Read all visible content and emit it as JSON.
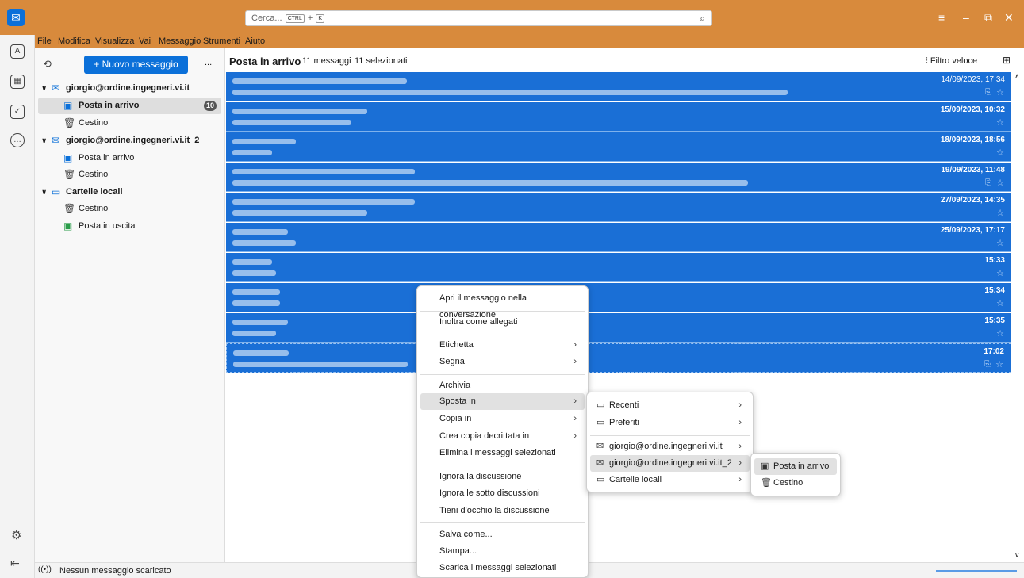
{
  "search": {
    "placeholder": "Cerca...",
    "kbd1": "CTRL",
    "plus": "+",
    "kbd2": "K"
  },
  "menubar": [
    "File",
    "Modifica",
    "Visualizza",
    "Vai",
    "Messaggio",
    "Strumenti",
    "Aiuto"
  ],
  "folders": {
    "new_message": "+ Nuovo messaggio",
    "more": "...",
    "items": [
      {
        "label": "giorgio@ordine.ingegneri.vi.it",
        "type": "account"
      },
      {
        "label": "Posta in arrivo",
        "type": "inbox",
        "unread": "10"
      },
      {
        "label": "Cestino",
        "type": "trash"
      },
      {
        "label": "giorgio@ordine.ingegneri.vi.it_2",
        "type": "account"
      },
      {
        "label": "Posta in arrivo",
        "type": "inbox"
      },
      {
        "label": "Cestino",
        "type": "trash"
      },
      {
        "label": "Cartelle locali",
        "type": "local"
      },
      {
        "label": "Cestino",
        "type": "trash"
      },
      {
        "label": "Posta in uscita",
        "type": "outbox"
      }
    ]
  },
  "list": {
    "title": "Posta in arrivo",
    "count": "11 messaggi",
    "selected": "11 selezionati",
    "quick_filter": "Filtro veloce",
    "messages": [
      {
        "date": "14/09/2023, 17:34",
        "attachment": true
      },
      {
        "date": "15/09/2023, 10:32",
        "attachment": false
      },
      {
        "date": "18/09/2023, 18:56",
        "attachment": false
      },
      {
        "date": "19/09/2023, 11:48",
        "attachment": true
      },
      {
        "date": "27/09/2023, 14:35",
        "attachment": false
      },
      {
        "date": "25/09/2023, 17:17",
        "attachment": false
      },
      {
        "date": "15:33",
        "attachment": false
      },
      {
        "date": "15:34",
        "attachment": false
      },
      {
        "date": "15:35",
        "attachment": false
      },
      {
        "date": "17:02",
        "attachment": true
      }
    ]
  },
  "context_menu": {
    "items": [
      "Apri il messaggio nella conversazione",
      "Inoltra come allegati",
      "Etichetta",
      "Segna",
      "Archivia",
      "Sposta in",
      "Copia in",
      "Crea copia decrittata in",
      "Elimina i messaggi selezionati",
      "Ignora la discussione",
      "Ignora le sotto discussioni",
      "Tieni d'occhio la discussione",
      "Salva come...",
      "Stampa...",
      "Scarica i messaggi selezionati"
    ]
  },
  "submenu_move": {
    "items": [
      "Recenti",
      "Preferiti",
      "giorgio@ordine.ingegneri.vi.it",
      "giorgio@ordine.ingegneri.vi.it_2",
      "Cartelle locali"
    ]
  },
  "submenu_account2": {
    "items": [
      "Posta in arrivo",
      "Cestino"
    ]
  },
  "status": {
    "text": "Nessun messaggio scaricato"
  },
  "colors": {
    "accent": "#0b70d9",
    "titlebar": "#d88a3c",
    "selection": "#1a6fd6"
  }
}
